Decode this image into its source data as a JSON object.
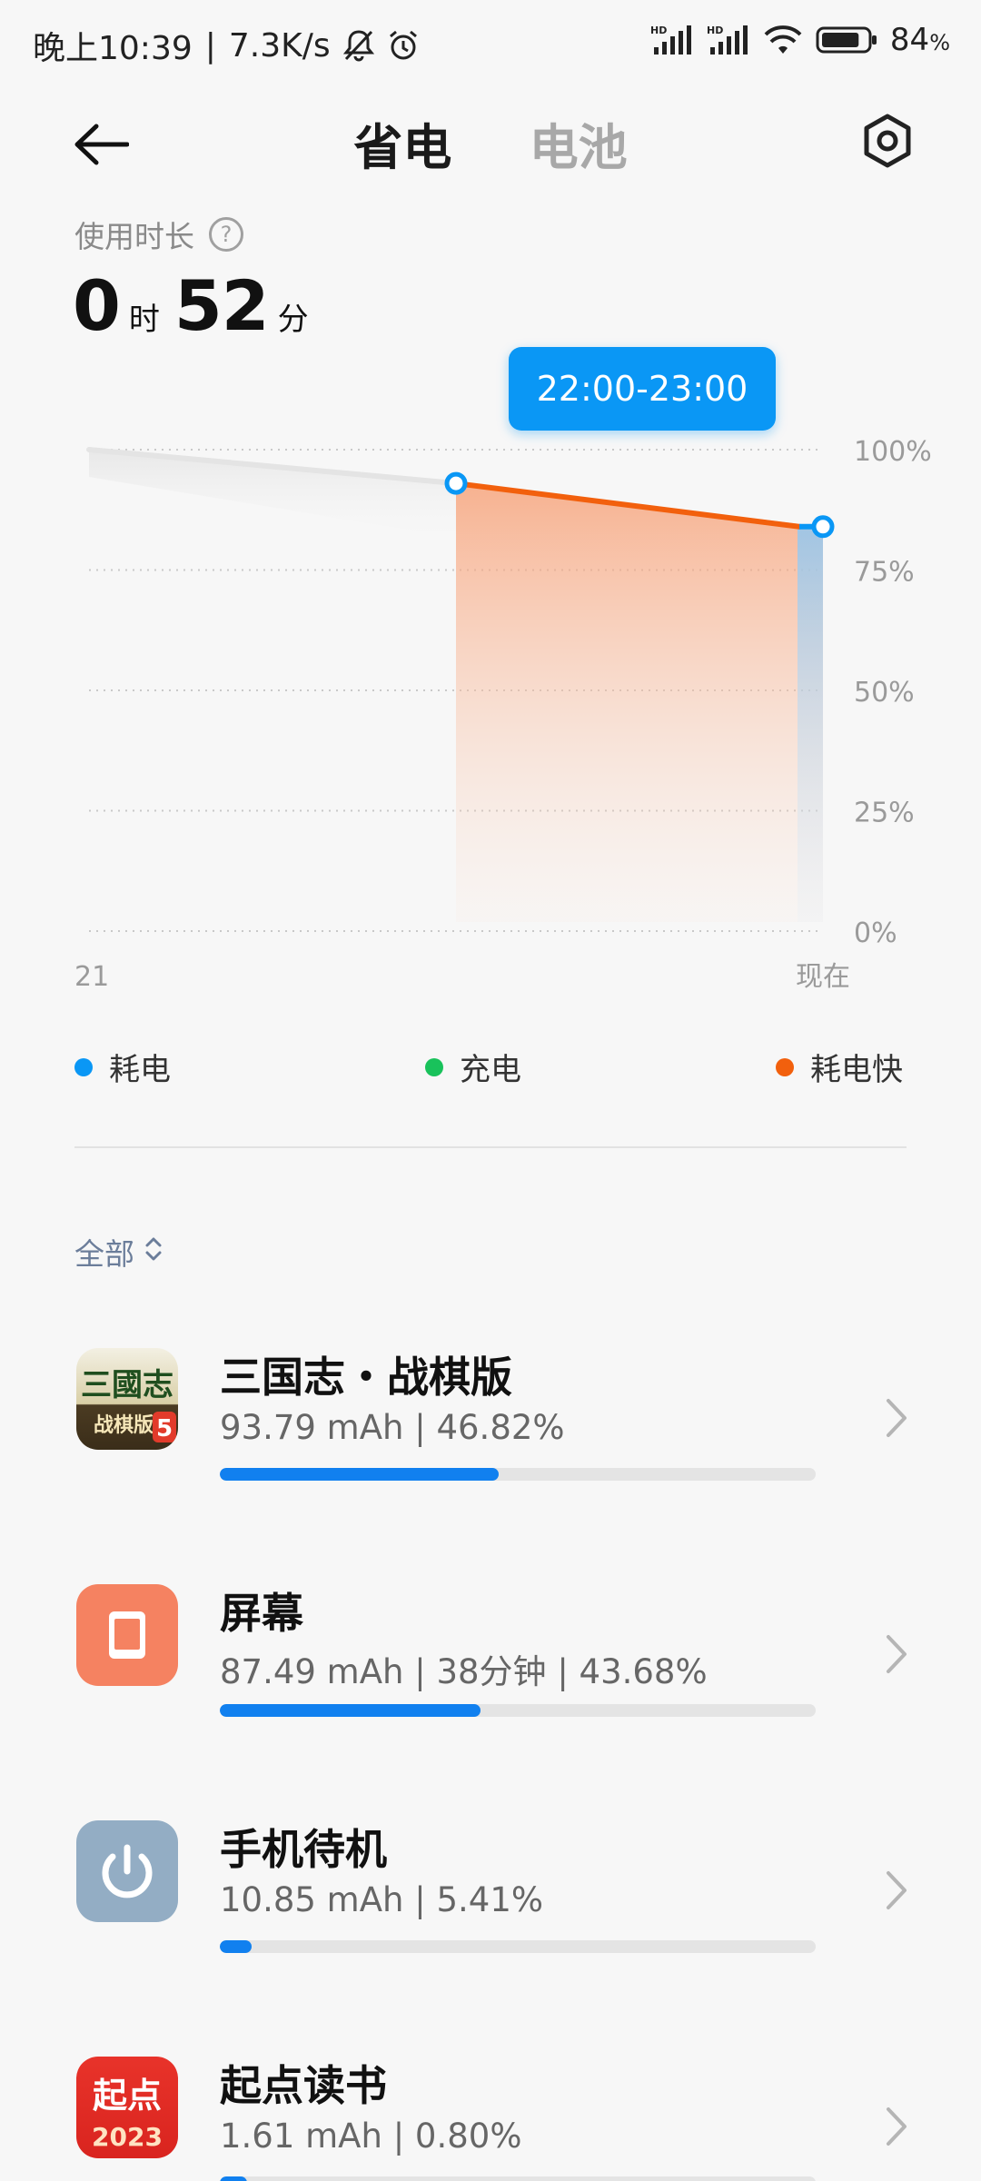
{
  "status_bar": {
    "time": "晚上10:39",
    "separator": "|",
    "net_speed": "7.3K/s",
    "battery_text": "84",
    "battery_percent_sign": "%",
    "battery_level": 0.84,
    "icons": [
      "mute-bell-icon",
      "alarm-icon",
      "hd-signal-icon",
      "hd-signal-icon",
      "wifi-icon",
      "battery-icon"
    ]
  },
  "header": {
    "tabs": [
      {
        "label": "省电",
        "active": true
      },
      {
        "label": "电池",
        "active": false
      }
    ]
  },
  "usage": {
    "label": "使用时长",
    "hours": "0",
    "hours_unit": "时",
    "minutes": "52",
    "minutes_unit": "分"
  },
  "chart_data": {
    "type": "line",
    "y_ticks": [
      "100%",
      "75%",
      "50%",
      "25%",
      "0%"
    ],
    "x_ticks": [
      "21",
      "现在"
    ],
    "selected_range": "22:00-23:00",
    "series": [
      {
        "name": "耗电",
        "color": "#0a97f5"
      },
      {
        "name": "充电",
        "color": "#19c25b"
      },
      {
        "name": "耗电快",
        "color": "#f2600d"
      }
    ],
    "points": [
      {
        "t": 0,
        "battery": 100,
        "segment": "history"
      },
      {
        "t": 1,
        "battery": 93,
        "segment": "fast"
      },
      {
        "t": 2,
        "battery": 84,
        "segment": "now"
      }
    ],
    "ylim": [
      0,
      100
    ]
  },
  "legend": [
    {
      "label": "耗电",
      "color": "#0a97f5"
    },
    {
      "label": "充电",
      "color": "#19c25b"
    },
    {
      "label": "耗电快",
      "color": "#f2600d"
    }
  ],
  "filter": {
    "label": "全部"
  },
  "apps": [
    {
      "name": "三国志・战棋版",
      "stats": "93.79 mAh | 46.82%",
      "fraction": 0.4682,
      "icon": "sanguozhi-app-icon"
    },
    {
      "name": "屏幕",
      "stats": "87.49 mAh | 38分钟 | 43.68%",
      "fraction": 0.4368,
      "icon": "screen-icon"
    },
    {
      "name": "手机待机",
      "stats": "10.85 mAh | 5.41%",
      "fraction": 0.0541,
      "icon": "standby-power-icon"
    },
    {
      "name": "起点读书",
      "stats": "1.61 mAh | 0.80%",
      "fraction": 0.008,
      "icon": "qidian-app-icon"
    }
  ],
  "app_icon_texts": {
    "sanguozhi": "三國志",
    "sanguozhi_sub": "战棋版",
    "sanguozhi_badge": "5",
    "qidian_top": "起点",
    "qidian_year": "2023"
  }
}
